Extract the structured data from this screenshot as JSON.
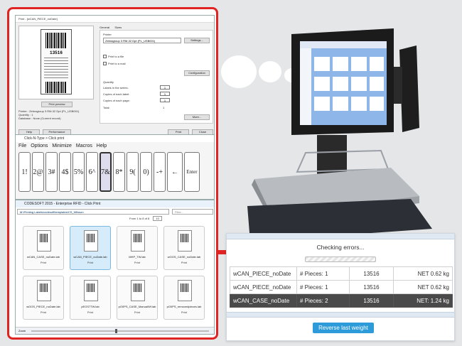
{
  "print_dialog": {
    "title": "Print - [wCAN_PIECE_noDate]",
    "label_number": "13516",
    "tabs": [
      "General",
      "Sizes"
    ],
    "printer_label": "Printer",
    "printer_value": "Zebragroup 3 RM-32 Dpt (PL_USB001)",
    "settings_button": "Settings...",
    "print_to_file": "Print to a file",
    "print_to_fax": "Print to a mail",
    "configuration_button": "Configuration",
    "quantity_label": "Quantity",
    "labels_in_series": "Labels in the series:",
    "copies_each_label": "Copies of each label:",
    "copies_each_page": "Copies of each page:",
    "total_label": "Total:",
    "total_value": "1",
    "spin_value": "1",
    "more_button": "More...",
    "print_preview_button": "Print preview",
    "info_printer": "Printer : Zebragroup 3 RM-32 Dpt (PL_USB001)",
    "info_quantity": "Quantity : 1",
    "info_database": "Database : None (Current record)",
    "help_button": "Help",
    "performance_button": "Performance",
    "print_button": "Print",
    "close_button": "Close"
  },
  "keyboard_window": {
    "title": "Click-N-Type > Click print",
    "menu": [
      "File",
      "Options",
      "Minimize",
      "Macros",
      "Help"
    ],
    "keys": [
      "1!",
      "2@",
      "3#",
      "4$",
      "5%",
      "6^",
      "7&",
      "8*",
      "9(",
      "0)",
      "-+",
      "←",
      "Enter"
    ],
    "pressed_key": "7&"
  },
  "click_print": {
    "title": "CODESOFT 2015 - Enterprise RFID - Click Print",
    "address": "M:\\Printing Labels\\codesoft\\templates\\CS_Wilsson",
    "filter_placeholder": "Filter...",
    "pager": "From 1 to 8 of 8",
    "page_size": "10",
    "print_label": "Print",
    "zoom_label": "Zoom",
    "tiles": [
      {
        "name": "wCAN_CASE_noDate.lab",
        "selected": false
      },
      {
        "name": "wCAN_PIECE_noDate.lab",
        "selected": true
      },
      {
        "name": "MHP_TW.lab",
        "selected": false
      },
      {
        "name": "wOOS_CASE_noDate.lab",
        "selected": false
      },
      {
        "name": "wOOS_PIECE_noDate.lab",
        "selected": false
      },
      {
        "name": "pEGS7TW.lab",
        "selected": false
      },
      {
        "name": "pO0PS_CASE_ManualWf.lab",
        "selected": false
      },
      {
        "name": "pO0PS_removedpieces.lab",
        "selected": false
      }
    ]
  },
  "results": {
    "status": "Checking errors...",
    "rows": [
      {
        "label": "wCAN_PIECE_noDate",
        "pieces": "# Pieces: 1",
        "code": "13516",
        "weight": "NET 0.62 kg",
        "highlight": false
      },
      {
        "label": "wCAN_PIECE_noDate",
        "pieces": "# Pieces: 1",
        "code": "13516",
        "weight": "NET 0.62 kg",
        "highlight": false
      },
      {
        "label": "wCAN_CASE_noDate",
        "pieces": "# Pieces: 2",
        "code": "13516",
        "weight": "NET: 1.24 kg",
        "highlight": true
      }
    ],
    "reverse_button": "Reverse last weight"
  },
  "colors": {
    "frame_red": "#e02424",
    "accent_blue": "#2d9bd9",
    "highlight_row": "#4a4a4a"
  }
}
